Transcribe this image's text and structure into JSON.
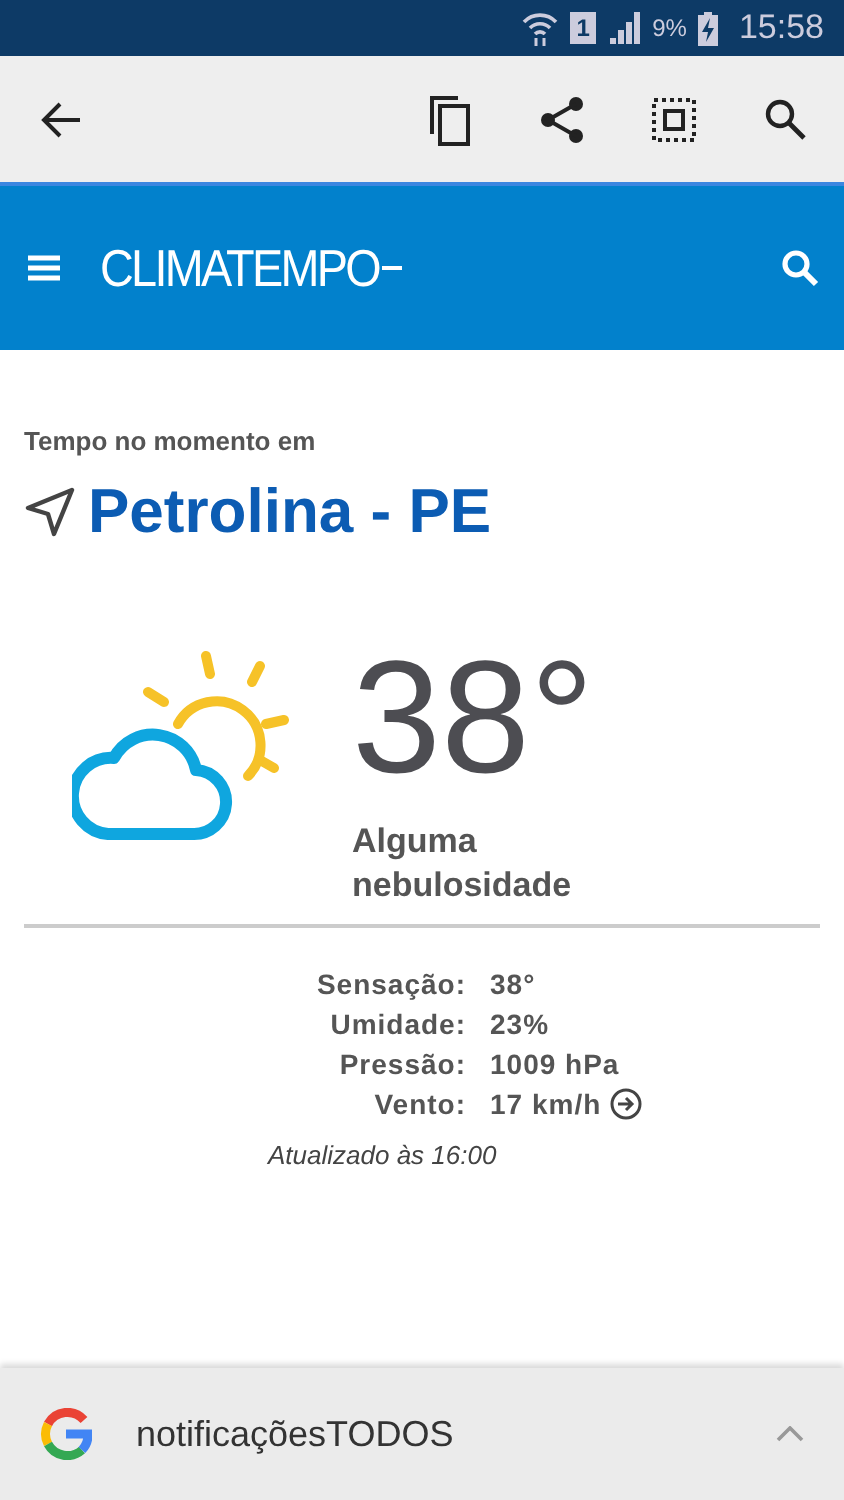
{
  "status_bar": {
    "sim_slot": "1",
    "battery": "9%",
    "time": "15:58"
  },
  "header": {
    "logo": "CLIMATEMPO"
  },
  "current": {
    "caption": "Tempo no momento em",
    "city": "Petrolina - PE",
    "temperature": "38°",
    "condition": "Alguma nebulosidade"
  },
  "details": [
    {
      "label": "Sensação:",
      "value": "38°",
      "kind": "plain"
    },
    {
      "label": "Umidade:",
      "value": "23%",
      "kind": "plain"
    },
    {
      "label": "Pressão:",
      "value": "1009 hPa",
      "kind": "plain"
    },
    {
      "label": "Vento:",
      "value": "17 km/h",
      "kind": "wind"
    }
  ],
  "updated": "Atualizado às 16:00",
  "notification": {
    "text": "notificaçõesTODOS"
  }
}
